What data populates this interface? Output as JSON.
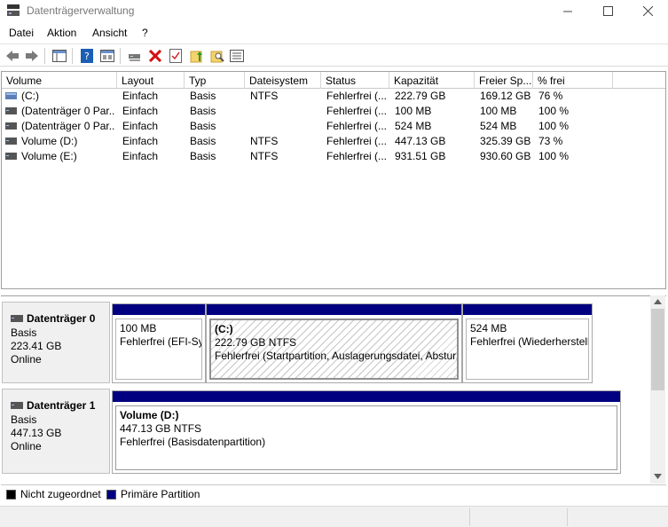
{
  "window": {
    "title": "Datenträgerverwaltung",
    "min_glyph": "—",
    "max_glyph": "☐",
    "close_glyph": "✕"
  },
  "menu": [
    "Datei",
    "Aktion",
    "Ansicht",
    "?"
  ],
  "toolbar": {
    "icons": [
      "back-arrow-icon",
      "forward-arrow-icon",
      "show-hide-console-tree-icon",
      "help-icon",
      "properties-pane-icon",
      "connect-drive-icon",
      "delete-icon",
      "check-properties-icon",
      "up-folder-icon",
      "search-folder-icon",
      "list-view-icon"
    ],
    "accent_red": "#d31212",
    "accent_blue": "#1a5fb4"
  },
  "volume_table": {
    "columns": [
      "Volume",
      "Layout",
      "Typ",
      "Dateisystem",
      "Status",
      "Kapazität",
      "Freier Sp...",
      "% frei"
    ],
    "rows": [
      [
        "(C:)",
        "Einfach",
        "Basis",
        "NTFS",
        "Fehlerfrei (...",
        "222.79 GB",
        "169.12 GB",
        "76 %"
      ],
      [
        "(Datenträger 0 Par...",
        "Einfach",
        "Basis",
        "",
        "Fehlerfrei (...",
        "100 MB",
        "100 MB",
        "100 %"
      ],
      [
        "(Datenträger 0 Par...",
        "Einfach",
        "Basis",
        "",
        "Fehlerfrei (...",
        "524 MB",
        "524 MB",
        "100 %"
      ],
      [
        "Volume (D:)",
        "Einfach",
        "Basis",
        "NTFS",
        "Fehlerfrei (...",
        "447.13 GB",
        "325.39 GB",
        "73 %"
      ],
      [
        "Volume (E:)",
        "Einfach",
        "Basis",
        "NTFS",
        "Fehlerfrei (...",
        "931.51 GB",
        "930.60 GB",
        "100 %"
      ]
    ]
  },
  "disks": [
    {
      "name": "Datenträger 0",
      "type": "Basis",
      "size": "223.41 GB",
      "state": "Online",
      "partitions": [
        {
          "title": "",
          "size": "100 MB",
          "status": "Fehlerfrei (EFI-Sys"
        },
        {
          "title": "(C:)",
          "size": "222.79 GB NTFS",
          "status": "Fehlerfrei (Startpartition, Auslagerungsdatei, Absturz"
        },
        {
          "title": "",
          "size": "524 MB",
          "status": "Fehlerfrei (Wiederherstell"
        }
      ]
    },
    {
      "name": "Datenträger 1",
      "type": "Basis",
      "size": "447.13 GB",
      "state": "Online",
      "partitions": [
        {
          "title": "Volume  (D:)",
          "size": "447.13 GB NTFS",
          "status": "Fehlerfrei (Basisdatenpartition)"
        }
      ]
    }
  ],
  "legend": [
    {
      "label": "Nicht zugeordnet",
      "color": "#000000"
    },
    {
      "label": "Primäre Partition",
      "color": "#000080"
    }
  ],
  "colors": {
    "primary_partition": "#000080",
    "unallocated": "#000000"
  }
}
